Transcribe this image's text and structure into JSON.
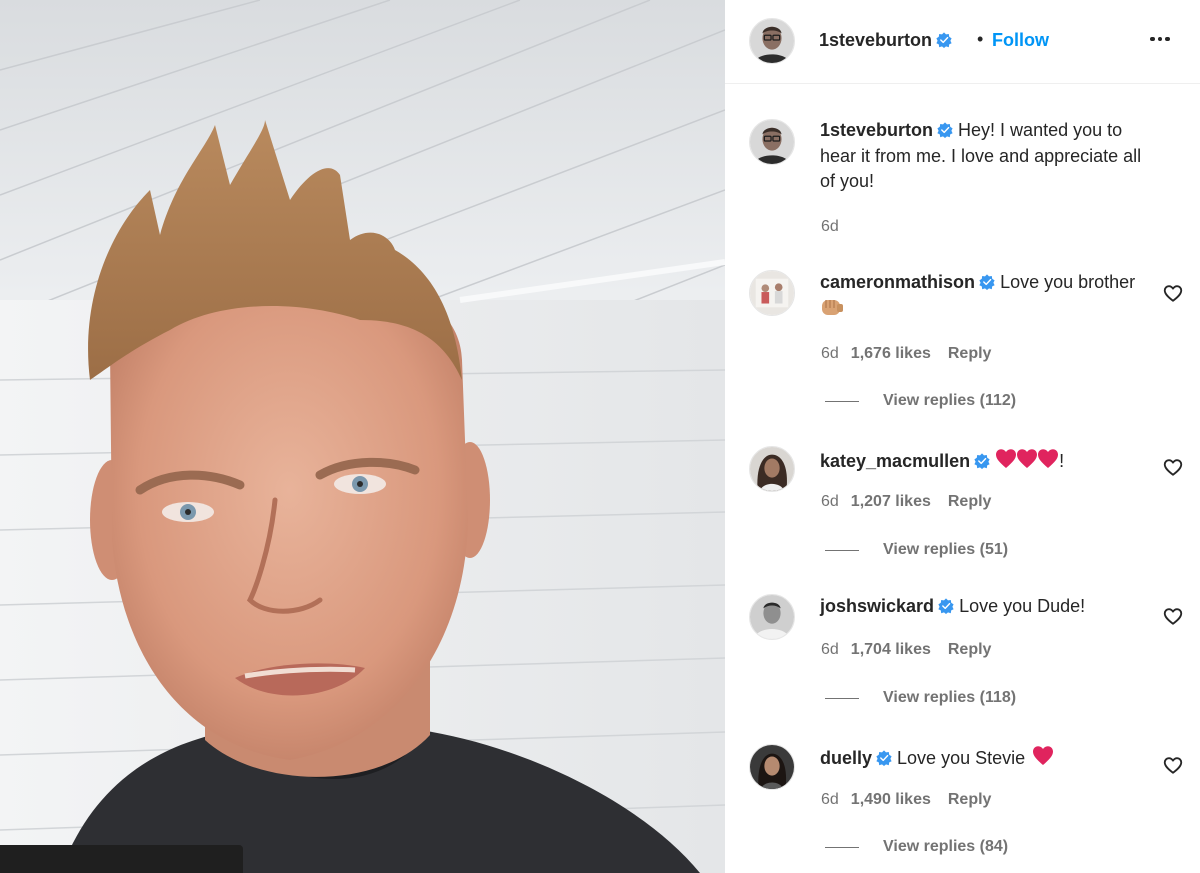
{
  "post": {
    "author": "1steveburton",
    "follow_label": "Follow",
    "separator": "•",
    "caption": "Hey! I wanted you to hear it from me. I love and appreciate all of you!",
    "time": "6d"
  },
  "comments": [
    {
      "user": "cameronmathison",
      "text": "Love you brother",
      "emoji": "fist-bump",
      "time": "6d",
      "likes": "1,676 likes",
      "reply": "Reply",
      "view_replies": "View replies (112)"
    },
    {
      "user": "katey_macmullen",
      "text": "!",
      "emoji": "three-hearts",
      "time": "6d",
      "likes": "1,207 likes",
      "reply": "Reply",
      "view_replies": "View replies (51)"
    },
    {
      "user": "joshswickard",
      "text": "Love you Dude!",
      "emoji": "",
      "time": "6d",
      "likes": "1,704 likes",
      "reply": "Reply",
      "view_replies": "View replies (118)"
    },
    {
      "user": "duelly",
      "text": "Love you Stevie",
      "emoji": "red-heart",
      "time": "6d",
      "likes": "1,490 likes",
      "reply": "Reply",
      "view_replies": "View replies (84)"
    }
  ],
  "colors": {
    "follow": "#0095f6",
    "verified": "#3897f0",
    "meta_text": "#737373",
    "heart_emoji": "#e0245e"
  },
  "icons": {
    "verified": "verified-badge-icon",
    "more": "more-options-icon",
    "like": "heart-outline-icon"
  }
}
